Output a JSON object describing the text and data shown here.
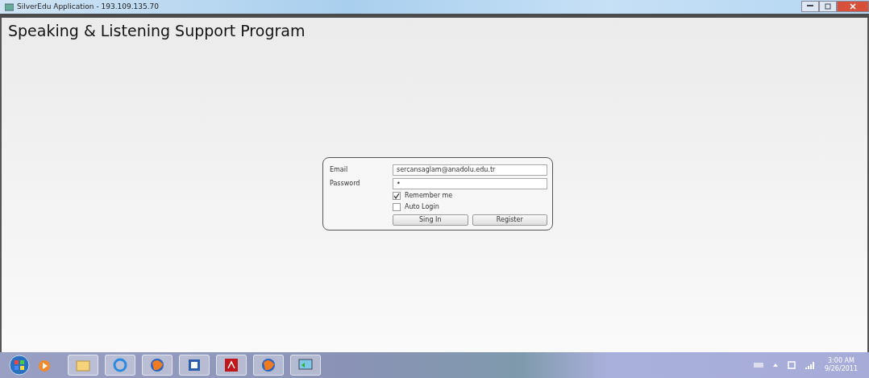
{
  "window": {
    "title": "SilverEdu Application - 193.109.135.70"
  },
  "app_title": "Speaking & Listening Support Program",
  "login": {
    "fields": [
      {
        "label": "Email",
        "value": "sercansaglam@anadolu.edu.tr",
        "kind": "text"
      },
      {
        "label": "Password",
        "value": "•",
        "kind": "password"
      }
    ],
    "options": [
      {
        "label": "Remember me",
        "checked": true
      },
      {
        "label": "Auto Login",
        "checked": false
      }
    ],
    "buttons": [
      "Sing In",
      "Register"
    ]
  },
  "clock": {
    "time": "3:00 AM",
    "date": "9/26/2011"
  }
}
